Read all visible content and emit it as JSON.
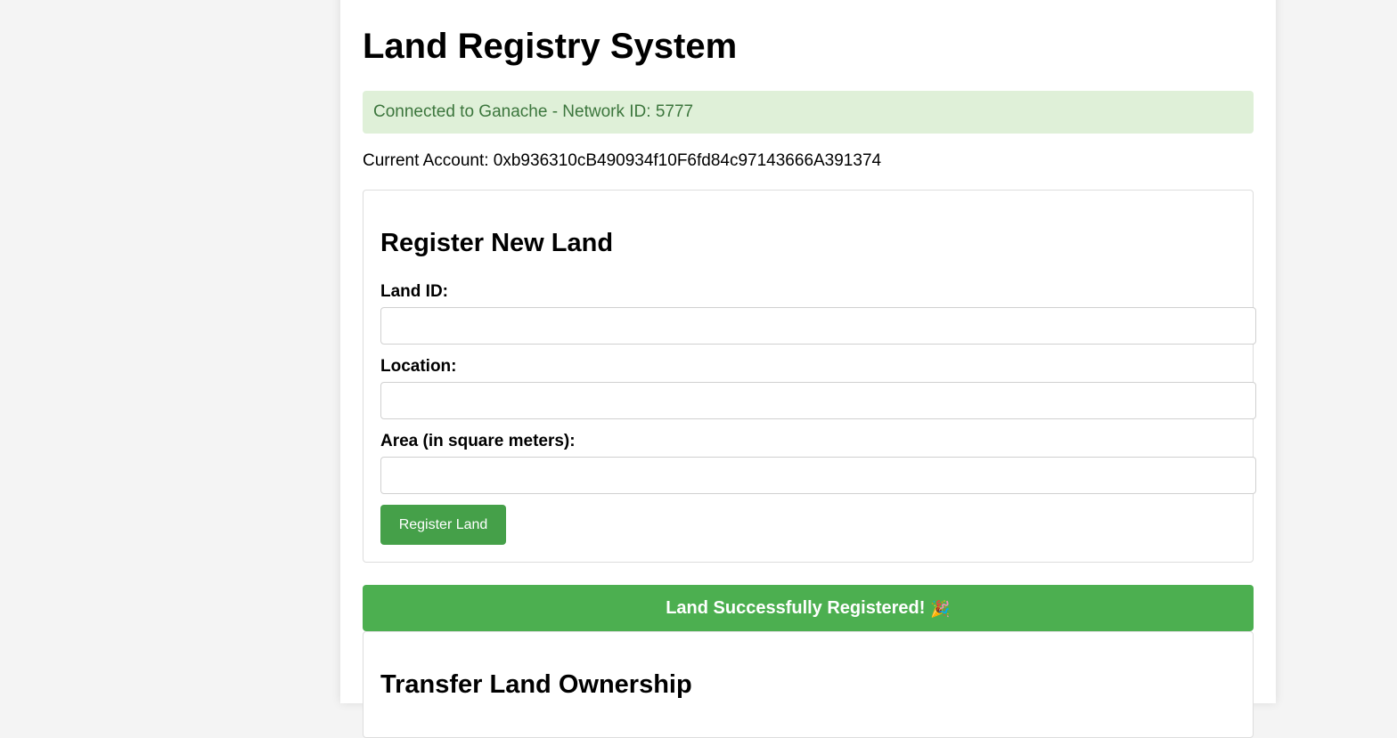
{
  "header": {
    "title": "Land Registry System"
  },
  "status": {
    "message": "Connected to Ganache - Network ID: 5777",
    "background_color": "#dff0d8",
    "text_color": "#3c763d"
  },
  "account": {
    "label": "Current Account: 0xb936310cB490934f10F6fd84c97143666A391374"
  },
  "register_form": {
    "title": "Register New Land",
    "fields": [
      {
        "label": "Land ID:",
        "value": "",
        "placeholder": ""
      },
      {
        "label": "Location:",
        "value": "",
        "placeholder": ""
      },
      {
        "label": "Area (in square meters):",
        "value": "",
        "placeholder": ""
      }
    ],
    "submit_label": "Register Land",
    "button_color": "#45a049"
  },
  "success_banner": {
    "message": "Land Successfully Registered!",
    "icon": "party-popper-icon",
    "icon_glyph": "🎉",
    "color": "#4caf50"
  },
  "transfer_form": {
    "title": "Transfer Land Ownership"
  }
}
